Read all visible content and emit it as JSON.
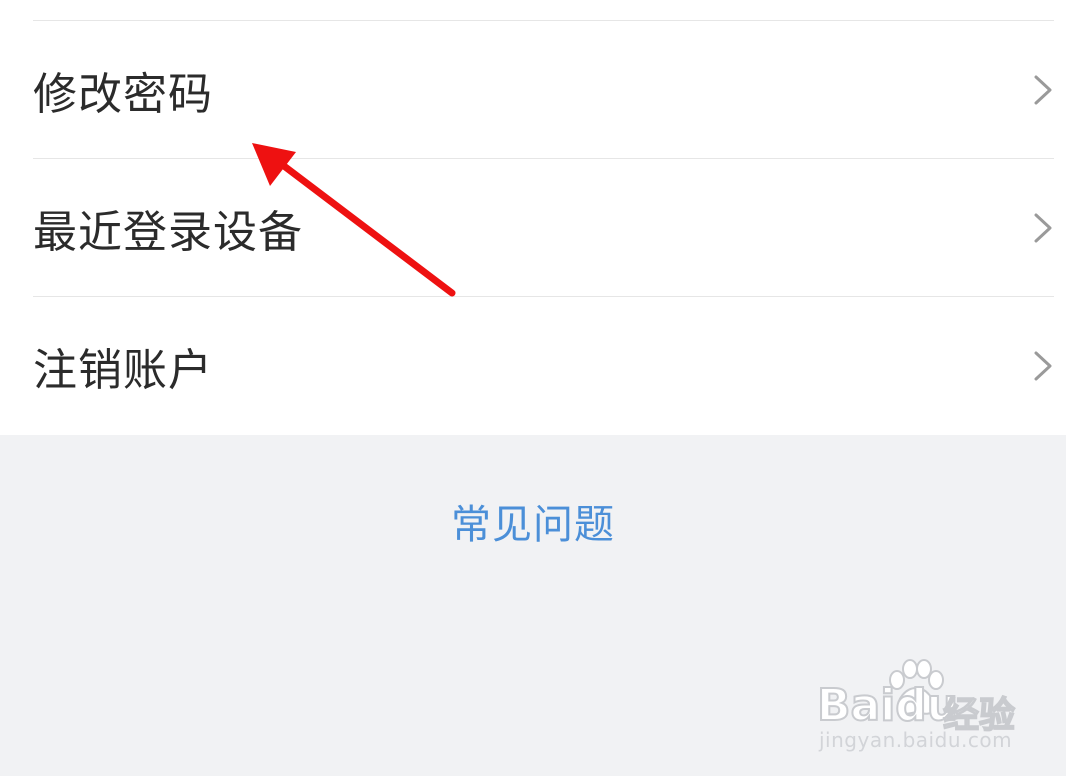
{
  "menu": {
    "items": [
      {
        "label": "修改密码",
        "icon": "chevron-right-icon"
      },
      {
        "label": "最近登录设备",
        "icon": "chevron-right-icon"
      },
      {
        "label": "注销账户",
        "icon": "chevron-right-icon"
      }
    ]
  },
  "faq": {
    "label": "常见问题"
  },
  "watermark": {
    "brand": "Baidu",
    "brand_suffix": "经验",
    "url": "jingyan.baidu.com"
  },
  "colors": {
    "background": "#f1f2f4",
    "panel": "#ffffff",
    "divider": "#e6e6e6",
    "text": "#2b2b2b",
    "link": "#4b8fd8",
    "chevron": "#9a9a9a",
    "annotation_arrow": "#ee1111"
  }
}
